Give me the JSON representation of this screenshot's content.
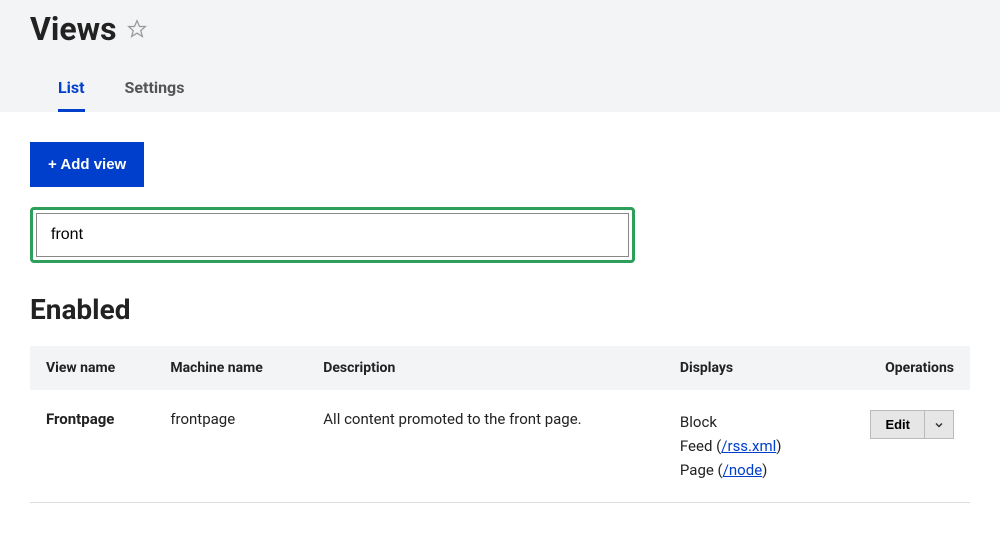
{
  "header": {
    "title": "Views",
    "tabs": {
      "list": "List",
      "settings": "Settings"
    }
  },
  "actions": {
    "add_view": "+ Add view"
  },
  "filter": {
    "value": "front"
  },
  "sections": {
    "enabled": "Enabled"
  },
  "table": {
    "headers": {
      "view_name": "View name",
      "machine_name": "Machine name",
      "description": "Description",
      "displays": "Displays",
      "operations": "Operations"
    },
    "rows": [
      {
        "view_name": "Frontpage",
        "machine_name": "frontpage",
        "description": "All content promoted to the front page.",
        "displays": {
          "block_label": "Block",
          "feed_label": "Feed (",
          "feed_link": "/rss.xml",
          "feed_close": ")",
          "page_label": "Page (",
          "page_link": "/node",
          "page_close": ")"
        },
        "edit_label": "Edit"
      }
    ]
  }
}
